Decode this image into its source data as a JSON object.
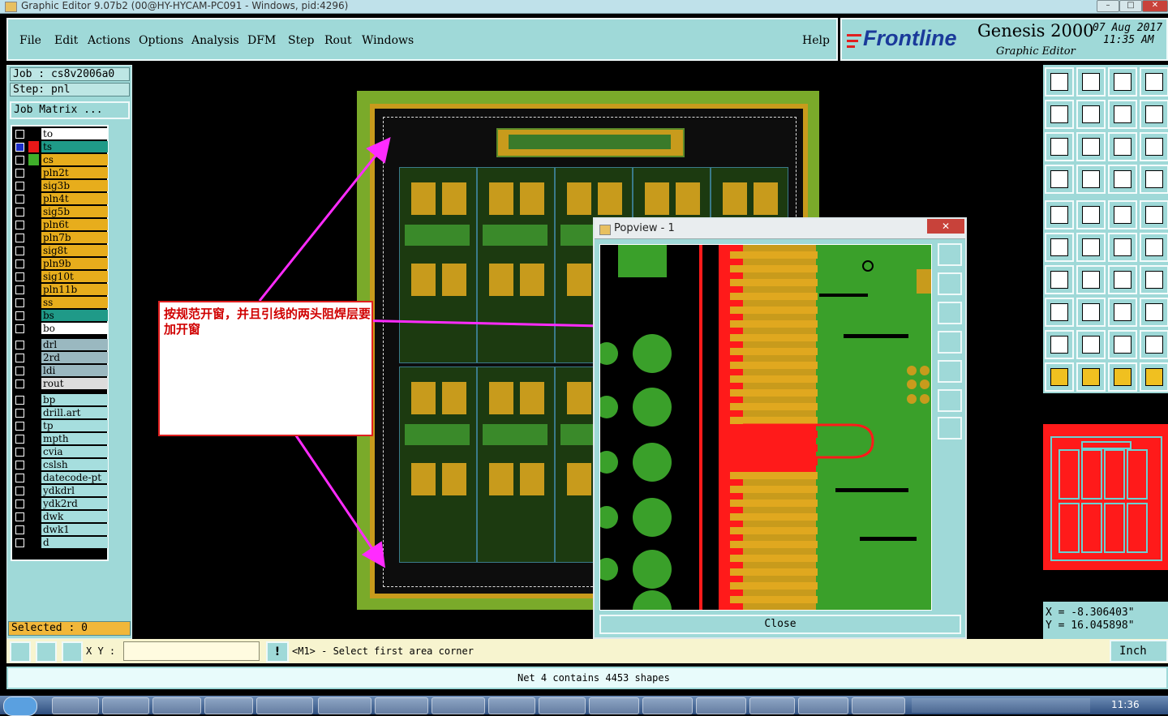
{
  "window": {
    "title": "Graphic Editor 9.07b2 (00@HY-HYCAM-PC091 - Windows, pid:4296)",
    "controls": [
      "–",
      "□",
      "✕"
    ]
  },
  "menu": {
    "items": [
      "File",
      "Edit",
      "Actions",
      "Options",
      "Analysis",
      "DFM",
      "Step",
      "Rout",
      "Windows"
    ],
    "help": "Help"
  },
  "brand": {
    "logo": "Frontline",
    "product": "Genesis 2000",
    "subtitle": "Graphic Editor",
    "date": "07 Aug 2017",
    "time": "11:35 AM"
  },
  "job": {
    "job_label": "Job : cs8v2006a0",
    "step_label": "Step: pnl",
    "matrix_button": "Job Matrix ...",
    "selected": "Selected : 0"
  },
  "layers": [
    {
      "name": "to",
      "color": "#ffffff",
      "swatch": "#000000",
      "state": "none"
    },
    {
      "name": "ts",
      "color": "#1f9a88",
      "swatch": "#e81818",
      "state": "selected"
    },
    {
      "name": "cs",
      "color": "#e7ad1c",
      "swatch": "#3fae2a",
      "state": "none"
    },
    {
      "name": "pln2t",
      "color": "#e7ad1c",
      "swatch": "#000000",
      "state": "none"
    },
    {
      "name": "sig3b",
      "color": "#e7ad1c",
      "swatch": "#000000",
      "state": "none"
    },
    {
      "name": "pln4t",
      "color": "#e7ad1c",
      "swatch": "#000000",
      "state": "none"
    },
    {
      "name": "sig5b",
      "color": "#e7ad1c",
      "swatch": "#000000",
      "state": "none"
    },
    {
      "name": "pln6t",
      "color": "#e7ad1c",
      "swatch": "#000000",
      "state": "none"
    },
    {
      "name": "pln7b",
      "color": "#e7ad1c",
      "swatch": "#000000",
      "state": "none"
    },
    {
      "name": "sig8t",
      "color": "#e7ad1c",
      "swatch": "#000000",
      "state": "none"
    },
    {
      "name": "pln9b",
      "color": "#e7ad1c",
      "swatch": "#000000",
      "state": "none"
    },
    {
      "name": "sig10t",
      "color": "#e7ad1c",
      "swatch": "#000000",
      "state": "none"
    },
    {
      "name": "pln11b",
      "color": "#e7ad1c",
      "swatch": "#000000",
      "state": "none"
    },
    {
      "name": "ss",
      "color": "#e7ad1c",
      "swatch": "#000000",
      "state": "none"
    },
    {
      "name": "bs",
      "color": "#1f9a88",
      "swatch": "#000000",
      "state": "none"
    },
    {
      "name": "bo",
      "color": "#ffffff",
      "swatch": "#000000",
      "state": "none"
    },
    {
      "name": "drl",
      "color": "#9ab8c0",
      "swatch": "#000000",
      "state": "none",
      "gap": true
    },
    {
      "name": "2rd",
      "color": "#9ab8c0",
      "swatch": "#000000",
      "state": "none"
    },
    {
      "name": "ldi",
      "color": "#9ab8c0",
      "swatch": "#000000",
      "state": "none"
    },
    {
      "name": "rout",
      "color": "#dcdcdc",
      "swatch": "#000000",
      "state": "none"
    },
    {
      "name": "bp",
      "color": "#a6dede",
      "swatch": "#000000",
      "state": "none",
      "gap": true
    },
    {
      "name": "drill.art",
      "color": "#a6dede",
      "swatch": "#000000",
      "state": "none"
    },
    {
      "name": "tp",
      "color": "#a6dede",
      "swatch": "#000000",
      "state": "none"
    },
    {
      "name": "mpth",
      "color": "#a6dede",
      "swatch": "#000000",
      "state": "none"
    },
    {
      "name": "cvia",
      "color": "#a6dede",
      "swatch": "#000000",
      "state": "none"
    },
    {
      "name": "cslsh",
      "color": "#a6dede",
      "swatch": "#000000",
      "state": "none"
    },
    {
      "name": "datecode-pt",
      "color": "#a6dede",
      "swatch": "#000000",
      "state": "none"
    },
    {
      "name": "ydkdrl",
      "color": "#a6dede",
      "swatch": "#000000",
      "state": "none"
    },
    {
      "name": "ydk2rd",
      "color": "#a6dede",
      "swatch": "#000000",
      "state": "none"
    },
    {
      "name": "dwk",
      "color": "#a6dede",
      "swatch": "#000000",
      "state": "none"
    },
    {
      "name": "dwk1",
      "color": "#a6dede",
      "swatch": "#000000",
      "state": "none"
    },
    {
      "name": "d",
      "color": "#a6dede",
      "swatch": "#000000",
      "state": "none"
    }
  ],
  "annotation": {
    "text": "按规范开窗，并且引线的两头阻焊层要加开窗"
  },
  "popview": {
    "title": "Popview - 1",
    "close_x": "✕",
    "close_button": "Close"
  },
  "coords": {
    "x": "X = -8.306403\"",
    "y": "Y = 16.045898\""
  },
  "status": {
    "xy_label": "X Y :",
    "prompt": "<M1> - Select first area corner",
    "units": "Inch",
    "message": "Net 4 contains 4453 shapes",
    "bang": "!"
  },
  "taskbar": {
    "clock": "11:36"
  },
  "colors": {
    "panel": "#9fd9d8",
    "board_green": "#7aaa2a",
    "copper": "#c89b1c",
    "highlight": "#ff1a1a",
    "annotation_arrow": "#ff2bff"
  }
}
